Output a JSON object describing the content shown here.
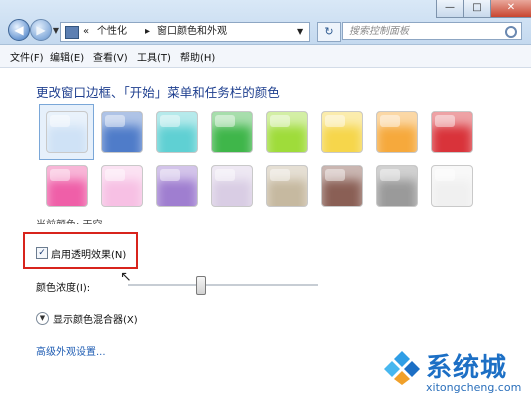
{
  "titlebar": {
    "breadcrumbs": [
      "«",
      "个性化",
      "窗口颜色和外观"
    ],
    "search_placeholder": "搜索控制面板",
    "back_icon": "back-arrow-icon",
    "forward_icon": "forward-arrow-icon",
    "window_controls": [
      "—",
      "□",
      "✕"
    ]
  },
  "menubar": {
    "items": [
      "文件(F)",
      "编辑(E)",
      "查看(V)",
      "工具(T)",
      "帮助(H)"
    ]
  },
  "content": {
    "heading": "更改窗口边框、「开始」菜单和任务栏的颜色",
    "swatches_row1": [
      "#cfe2f6",
      "#4f7cc9",
      "#5fd0d3",
      "#3fb64a",
      "#9fdc3a",
      "#f6d64b",
      "#f6a93c",
      "#d9333a"
    ],
    "swatches_row2": [
      "#ef5fa8",
      "#f7c0e4",
      "#9f7ed0",
      "#d9cde4",
      "#c6b9a0",
      "#8a5f55",
      "#9a9a9a",
      "#f0f0f0"
    ],
    "current_color_label": "当前颜色: 天空",
    "transparency_checked": true,
    "transparency_label": "启用透明效果(N)",
    "intensity_label": "颜色浓度(I):",
    "intensity_level": 0.38,
    "mixer_label": "显示颜色混合器(X)",
    "advanced_link": "高级外观设置..."
  },
  "watermark": {
    "brand": "系统城",
    "url": "xitongcheng.com"
  },
  "colors": {
    "heading": "#1e3f8f",
    "highlight_box": "#d8241c",
    "link": "#1f5db3"
  }
}
